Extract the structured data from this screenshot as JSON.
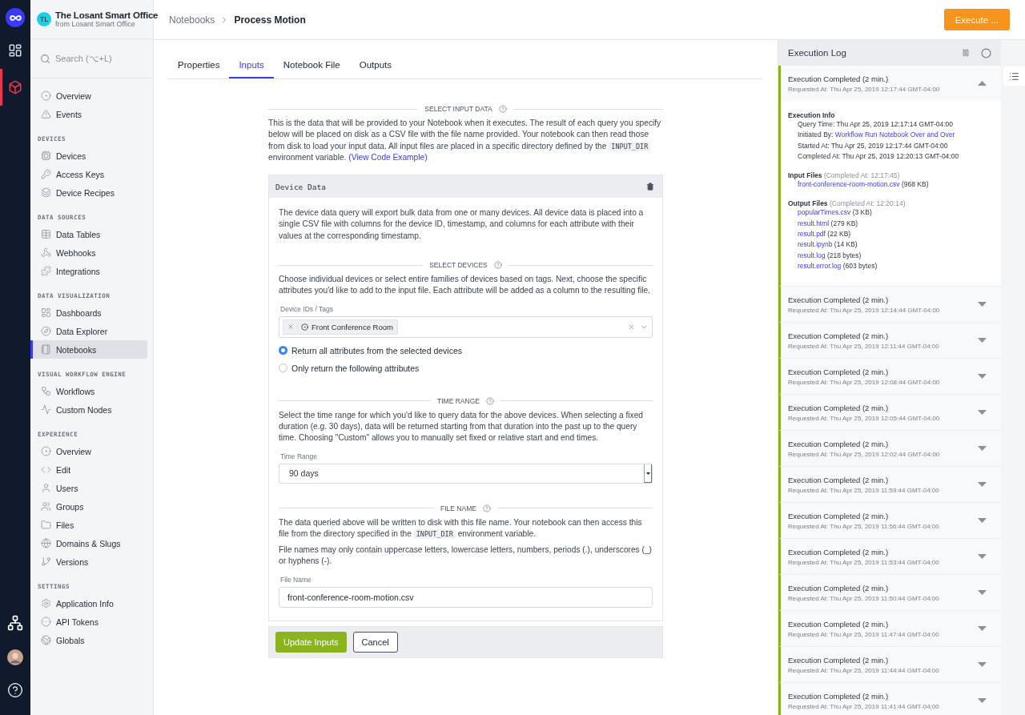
{
  "rail": {
    "items": [
      {
        "selected": false
      },
      {
        "selected": true
      }
    ]
  },
  "app": {
    "initials": "TL",
    "name": "The Losant Smart Office",
    "owner": "from Losant Smart Office"
  },
  "search": {
    "placeholder": "Search (⌥+L)"
  },
  "sidebar": {
    "sections": [
      {
        "items": [
          {
            "label": "Overview",
            "selected": false
          },
          {
            "label": "Events",
            "selected": false
          }
        ]
      },
      {
        "title": "DEVICES",
        "items": [
          {
            "label": "Devices",
            "selected": false
          },
          {
            "label": "Access Keys",
            "selected": false
          },
          {
            "label": "Device Recipes",
            "selected": false
          }
        ]
      },
      {
        "title": "DATA SOURCES",
        "items": [
          {
            "label": "Data Tables",
            "selected": false
          },
          {
            "label": "Webhooks",
            "selected": false
          },
          {
            "label": "Integrations",
            "selected": false
          }
        ]
      },
      {
        "title": "DATA VISUALIZATION",
        "items": [
          {
            "label": "Dashboards",
            "selected": false
          },
          {
            "label": "Data Explorer",
            "selected": false
          },
          {
            "label": "Notebooks",
            "selected": true
          }
        ]
      },
      {
        "title": "VISUAL WORKFLOW ENGINE",
        "items": [
          {
            "label": "Workflows",
            "selected": false
          },
          {
            "label": "Custom Nodes",
            "selected": false
          }
        ]
      },
      {
        "title": "EXPERIENCE",
        "items": [
          {
            "label": "Overview",
            "selected": false
          },
          {
            "label": "Edit",
            "selected": false
          },
          {
            "label": "Users",
            "selected": false
          },
          {
            "label": "Groups",
            "selected": false
          },
          {
            "label": "Files",
            "selected": false
          },
          {
            "label": "Domains & Slugs",
            "selected": false
          },
          {
            "label": "Versions",
            "selected": false
          }
        ]
      },
      {
        "title": "SETTINGS",
        "items": [
          {
            "label": "Application Info",
            "selected": false
          },
          {
            "label": "API Tokens",
            "selected": false
          },
          {
            "label": "Globals",
            "selected": false
          }
        ]
      }
    ]
  },
  "breadcrumb": [
    "Notebooks",
    "Process Motion"
  ],
  "execute_button": "Execute ...",
  "tabs": [
    {
      "label": "Properties",
      "selected": false
    },
    {
      "label": "Inputs",
      "selected": true
    },
    {
      "label": "Notebook File",
      "selected": false
    },
    {
      "label": "Outputs",
      "selected": false
    }
  ],
  "input_section": {
    "title": "SELECT INPUT DATA",
    "parts": [
      {
        "kind": "text",
        "text": "This is the data that will be provided to your Notebook when it executes. The result of each query you specify below will be placed on disk as a CSV file with the file name provided. Your notebook can then read those from disk to load your input data. All input files are placed in a specific directory defined by the "
      },
      {
        "kind": "code",
        "text": "INPUT_DIR"
      },
      {
        "kind": "text",
        "text": " environment variable. "
      },
      {
        "kind": "link",
        "text": "(View Code Example)"
      }
    ]
  },
  "device_data": {
    "title": "Device Data",
    "description": "The device data query will export bulk data from one or many devices. All device data is placed into a single CSV file with columns for the device ID, timestamp, and columns for each attribute with their values at the corresponding timestamp.",
    "devices_section": {
      "title": "SELECT DEVICES",
      "description": "Choose individual devices or select entire families of devices based on tags. Next, choose the specific attributes you'd like to add to the input file. Each attribute will be added as a column to the resulting file."
    },
    "devices_field": {
      "label": "Device IDs / Tags",
      "chips": [
        "Front Conference Room"
      ]
    },
    "attribute_options": [
      {
        "label": "Return all attributes from the selected devices",
        "selected": true
      },
      {
        "label": "Only return the following attributes",
        "selected": false
      }
    ],
    "time_section": {
      "title": "TIME RANGE",
      "description": "Select the time range for which you'd like to query data for the above devices. When selecting a fixed duration (e.g. 30 days), data will be returned starting from that duration into the past up to the query time. Choosing \"Custom\" allows you to manually set fixed or relative start and end times."
    },
    "time_field": {
      "label": "Time Range",
      "value": "90 days"
    },
    "file_section": {
      "title": "FILE NAME",
      "parts": [
        {
          "kind": "text",
          "text": "The data queried above will be written to disk with this file name. Your notebook can then access this file from the directory specified in the "
        },
        {
          "kind": "code",
          "text": "INPUT_DIR"
        },
        {
          "kind": "text",
          "text": " environment variable."
        }
      ],
      "note": "File names may only contain uppercase letters, lowercase letters, numbers, periods (.), underscores (_) or hyphens (-)."
    },
    "file_field": {
      "label": "File Name",
      "value": "front-conference-room-motion.csv"
    }
  },
  "actions": {
    "primary": "Update Inputs",
    "secondary": "Cancel"
  },
  "log": {
    "title": "Execution Log",
    "entries": [
      {
        "title": "Execution Completed (2 min.)",
        "requested": "Requested At: Thu Apr 25, 2019 12:17:44 GMT-04:00",
        "expanded": true,
        "details": {
          "info_title": "Execution Info",
          "info": [
            {
              "kind": "text",
              "label": "Query Time:",
              "value": "Thu Apr 25, 2019 12:17:14 GMT-04:00"
            },
            {
              "kind": "link",
              "label": "Initiated By:",
              "value": "Workflow Run Notebook Over and Over"
            },
            {
              "kind": "text",
              "label": "Started At:",
              "value": "Thu Apr 25, 2019 12:17:44 GMT-04:00"
            },
            {
              "kind": "text",
              "label": "Completed At:",
              "value": "Thu Apr 25, 2019 12:20:13 GMT-04:00"
            }
          ],
          "file_groups": [
            {
              "title": "Input Files",
              "note": "(Completed At: 12:17:45)",
              "files": [
                {
                  "name": "front-conference-room-motion.csv",
                  "size": "(968 KB)"
                }
              ]
            },
            {
              "title": "Output Files",
              "note": "(Completed At: 12:20:14)",
              "files": [
                {
                  "name": "popularTimes.csv",
                  "size": "(3 KB)"
                },
                {
                  "name": "result.html",
                  "size": "(279 KB)"
                },
                {
                  "name": "result.pdf",
                  "size": "(22 KB)"
                },
                {
                  "name": "result.ipynb",
                  "size": "(14 KB)"
                },
                {
                  "name": "result.log",
                  "size": "(218 bytes)"
                },
                {
                  "name": "result.error.log",
                  "size": "(603 bytes)"
                }
              ]
            }
          ]
        }
      },
      {
        "title": "Execution Completed (2 min.)",
        "requested": "Requested At: Thu Apr 25, 2019 12:14:44 GMT-04:00",
        "expanded": false
      },
      {
        "title": "Execution Completed (2 min.)",
        "requested": "Requested At: Thu Apr 25, 2019 12:11:44 GMT-04:00",
        "expanded": false
      },
      {
        "title": "Execution Completed (2 min.)",
        "requested": "Requested At: Thu Apr 25, 2019 12:08:44 GMT-04:00",
        "expanded": false
      },
      {
        "title": "Execution Completed (2 min.)",
        "requested": "Requested At: Thu Apr 25, 2019 12:05:44 GMT-04:00",
        "expanded": false
      },
      {
        "title": "Execution Completed (2 min.)",
        "requested": "Requested At: Thu Apr 25, 2019 12:02:44 GMT-04:00",
        "expanded": false
      },
      {
        "title": "Execution Completed (2 min.)",
        "requested": "Requested At: Thu Apr 25, 2019 11:59:44 GMT-04:00",
        "expanded": false
      },
      {
        "title": "Execution Completed (2 min.)",
        "requested": "Requested At: Thu Apr 25, 2019 11:56:44 GMT-04:00",
        "expanded": false
      },
      {
        "title": "Execution Completed (2 min.)",
        "requested": "Requested At: Thu Apr 25, 2019 11:53:44 GMT-04:00",
        "expanded": false
      },
      {
        "title": "Execution Completed (2 min.)",
        "requested": "Requested At: Thu Apr 25, 2019 11:50:44 GMT-04:00",
        "expanded": false
      },
      {
        "title": "Execution Completed (2 min.)",
        "requested": "Requested At: Thu Apr 25, 2019 11:47:44 GMT-04:00",
        "expanded": false
      },
      {
        "title": "Execution Completed (2 min.)",
        "requested": "Requested At: Thu Apr 25, 2019 11:44:44 GMT-04:00",
        "expanded": false
      },
      {
        "title": "Execution Completed (2 min.)",
        "requested": "Requested At: Thu Apr 25, 2019 11:41:44 GMT-04:00",
        "expanded": false
      }
    ]
  }
}
